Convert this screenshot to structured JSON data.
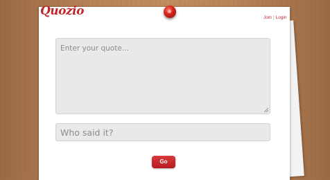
{
  "brand": {
    "logo": "Quozio"
  },
  "header": {
    "join_label": "Join",
    "separator": "|",
    "login_label": "Login"
  },
  "form": {
    "quote_placeholder": "Enter your quote...",
    "author_placeholder": "Who said it?",
    "submit_label": "Go"
  },
  "colors": {
    "accent": "#c0262c",
    "background_wood": "#b98458",
    "field_bg": "#e9e9e9"
  },
  "icons": {
    "pin": "pushpin-icon",
    "resize": "resize-handle-icon"
  }
}
